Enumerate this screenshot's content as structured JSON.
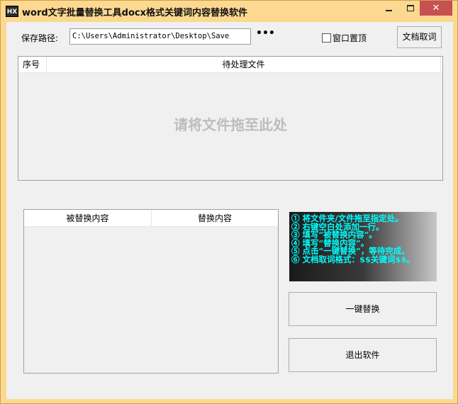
{
  "window": {
    "icon_text": "HX",
    "title": "word文字批量替换工具docx格式关键词内容替换软件"
  },
  "toolbar": {
    "path_label": "保存路径:",
    "path_value": "C:\\Users\\Administrator\\Desktop\\Save",
    "browse_label": "•••",
    "ontop_label": "窗口置顶",
    "ontop_checked": false,
    "doc_btn_label": "文档取词"
  },
  "file_list": {
    "columns": [
      "序号",
      "待处理文件"
    ],
    "rows": [],
    "drop_hint": "请将文件拖至此处"
  },
  "replace_table": {
    "columns": [
      "被替换内容",
      "替换内容"
    ],
    "rows": []
  },
  "instructions": [
    "① 将文件夹/文件拖至指定处。",
    "② 右键空白处添加一行。",
    "③ 填写“被替换内容”。",
    "④ 填写“替换内容”。",
    "⑤ 点击“一键替换”，等待完成。",
    "⑥ 文档取词格式：$$关键词$$。"
  ],
  "actions": {
    "run_label": "一键替换",
    "exit_label": "退出软件"
  },
  "colors": {
    "titlebar": "#fcd890",
    "close_button": "#c75050",
    "instruction_text": "#00ffff",
    "drop_hint": "#bdbdbd"
  }
}
